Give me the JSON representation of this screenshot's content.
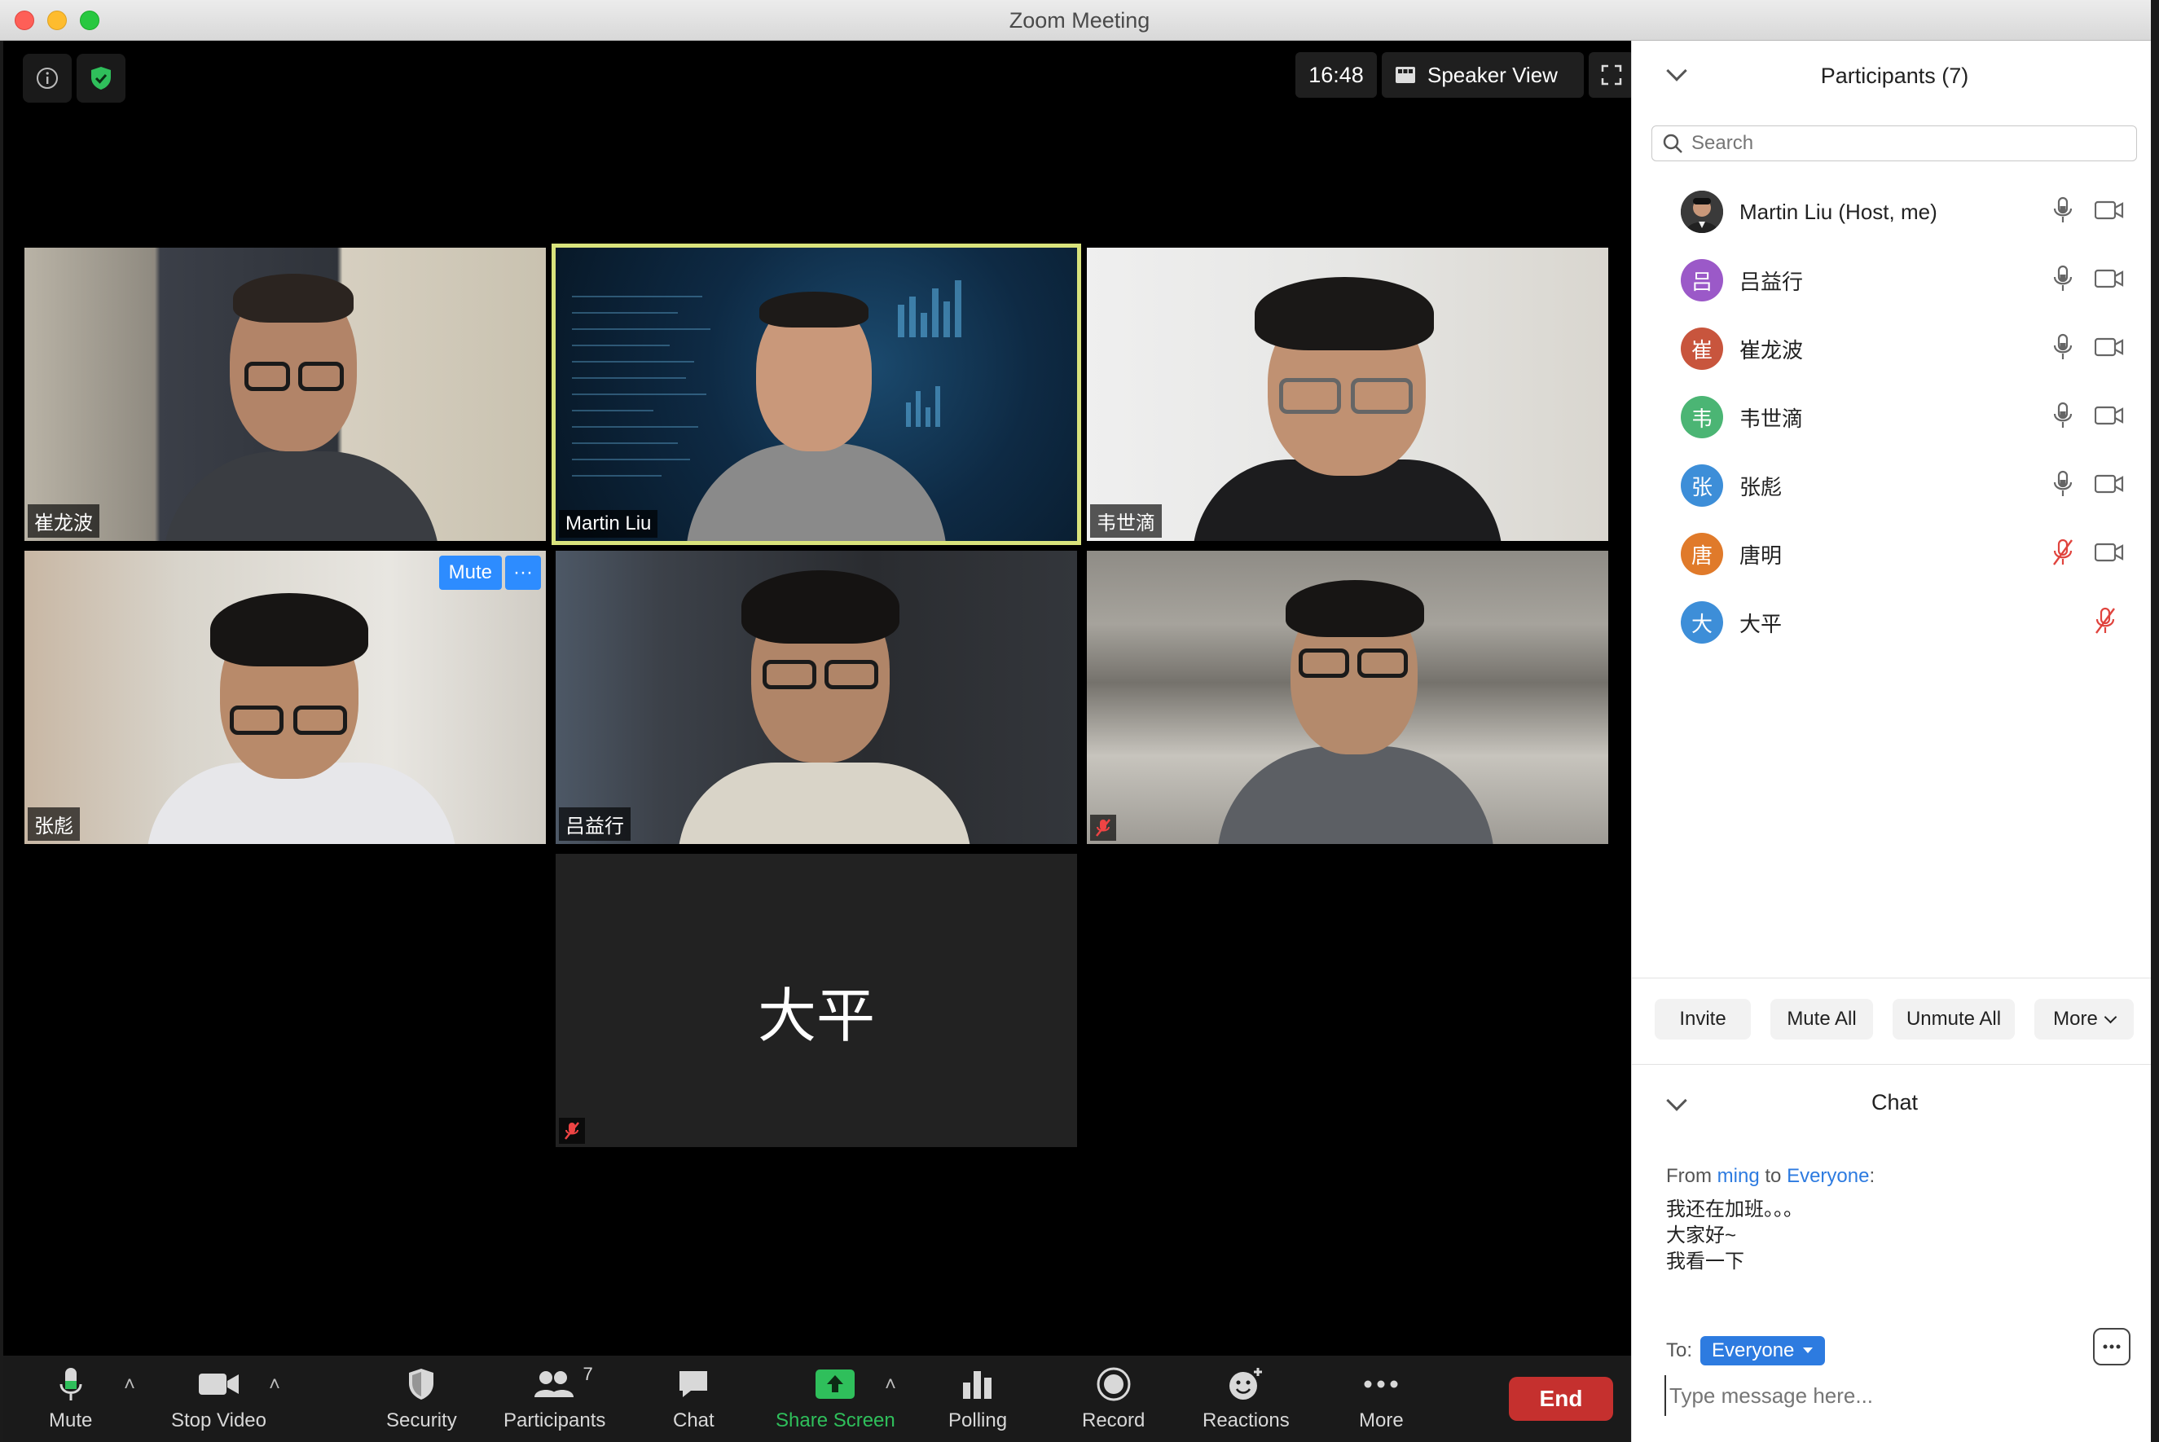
{
  "window": {
    "title": "Zoom Meeting"
  },
  "top_bar": {
    "clock": "16:48",
    "view_label": "Speaker View"
  },
  "tiles": [
    {
      "name": "崔龙波"
    },
    {
      "name": "Martin Liu"
    },
    {
      "name": "韦世滴"
    },
    {
      "name": "张彪"
    },
    {
      "name": "吕益行"
    },
    {
      "name": ""
    },
    {
      "name": "大平"
    }
  ],
  "hover": {
    "mute_label": "Mute",
    "more_label": "···"
  },
  "toolbar": {
    "mute": "Mute",
    "stop_video": "Stop Video",
    "security": "Security",
    "participants": "Participants",
    "participants_count": "7",
    "chat": "Chat",
    "share_screen": "Share Screen",
    "polling": "Polling",
    "record": "Record",
    "reactions": "Reactions",
    "more": "More",
    "end": "End"
  },
  "participants_panel": {
    "title": "Participants (7)",
    "search_placeholder": "Search",
    "items": [
      {
        "name": "Martin Liu (Host, me)",
        "initial": "",
        "color": "#2a2a2a",
        "muted": false,
        "video": true
      },
      {
        "name": "吕益行",
        "initial": "吕",
        "color": "#9b59c8",
        "muted": false,
        "video": true
      },
      {
        "name": "崔龙波",
        "initial": "崔",
        "color": "#c8553d",
        "muted": false,
        "video": true
      },
      {
        "name": "韦世滴",
        "initial": "韦",
        "color": "#4bb574",
        "muted": false,
        "video": true
      },
      {
        "name": "张彪",
        "initial": "张",
        "color": "#3d8ed8",
        "muted": false,
        "video": true
      },
      {
        "name": "唐明",
        "initial": "唐",
        "color": "#e07a2a",
        "muted": true,
        "video": true
      },
      {
        "name": "大平",
        "initial": "大",
        "color": "#3d8ed8",
        "muted": true,
        "video": false
      }
    ],
    "buttons": {
      "invite": "Invite",
      "mute_all": "Mute All",
      "unmute_all": "Unmute All",
      "more": "More"
    }
  },
  "chat": {
    "title": "Chat",
    "from_prefix": "From",
    "from_user": "ming",
    "to_word": "to",
    "to_target": "Everyone",
    "messages": [
      "我还在加班。。。",
      "大家好~",
      "我看一下"
    ],
    "to_label": "To:",
    "recipient": "Everyone",
    "input_placeholder": "Type message here..."
  }
}
